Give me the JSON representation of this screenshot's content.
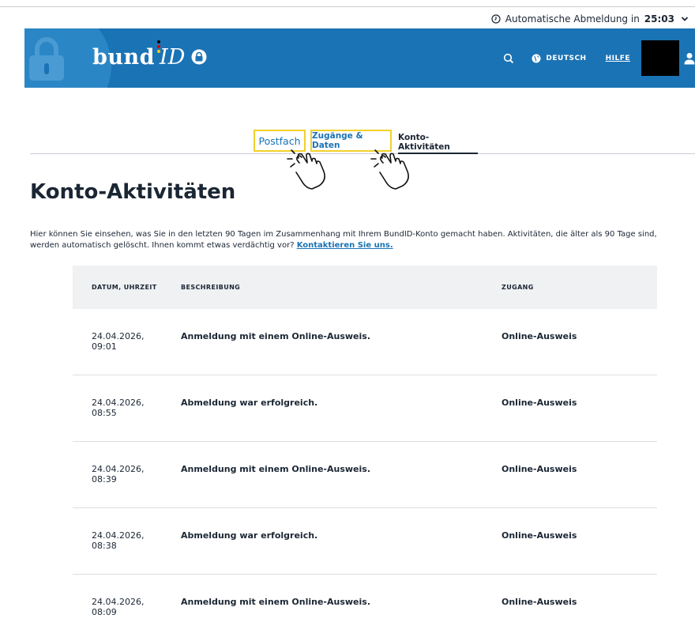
{
  "session": {
    "logout_prefix": "Automatische Abmeldung in",
    "logout_time": "25:03"
  },
  "header": {
    "brand_word": "bund",
    "brand_id": "ID",
    "language": "DEUTSCH",
    "help": "HILFE",
    "colors": {
      "brand_blue": "#1a73b5",
      "accent_yellow": "#f1d12b"
    },
    "icons": [
      "lock-icon",
      "search-icon",
      "globe-icon",
      "user-icon",
      "padlock-icon"
    ]
  },
  "tabs": [
    {
      "label": "Postfach"
    },
    {
      "label": "Zugänge & Daten"
    },
    {
      "label": "Konto-Aktivitäten",
      "active": true
    }
  ],
  "page": {
    "title": "Konto-Aktivitäten",
    "intro": "Hier können Sie einsehen, was Sie in den letzten 90 Tagen im Zusammenhang mit Ihrem BundID-Konto gemacht haben. Aktivitäten, die älter als 90 Tage sind, werden automatisch gelöscht. Ihnen kommt etwas verdächtig vor?",
    "contact_link": "Kontaktieren Sie uns."
  },
  "table": {
    "headers": {
      "date": "DATUM, UHRZEIT",
      "description": "BESCHREIBUNG",
      "access": "ZUGANG"
    },
    "rows": [
      {
        "date": "24.04.2026,",
        "time": "09:01",
        "description": "Anmeldung mit einem Online-Ausweis.",
        "access": "Online-Ausweis"
      },
      {
        "date": "24.04.2026,",
        "time": "08:55",
        "description": "Abmeldung war erfolgreich.",
        "access": "Online-Ausweis"
      },
      {
        "date": "24.04.2026,",
        "time": "08:39",
        "description": "Anmeldung mit einem Online-Ausweis.",
        "access": "Online-Ausweis"
      },
      {
        "date": "24.04.2026,",
        "time": "08:38",
        "description": "Abmeldung war erfolgreich.",
        "access": "Online-Ausweis"
      },
      {
        "date": "24.04.2026,",
        "time": "08:09",
        "description": "Anmeldung mit einem Online-Ausweis.",
        "access": "Online-Ausweis"
      }
    ]
  }
}
